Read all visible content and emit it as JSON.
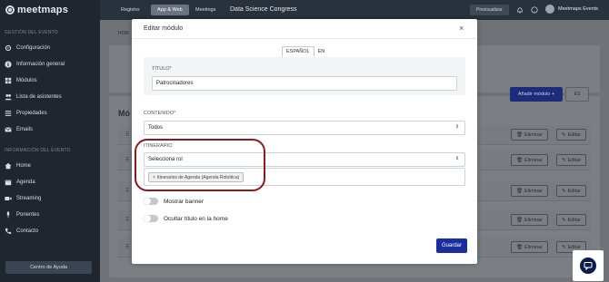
{
  "app": {
    "logo_text": "meetmaps"
  },
  "sidebar": {
    "section_event": "GESTIÓN DEL EVENTO",
    "section_info": "INFORMACIÓN DEL EVENTO",
    "items_event": [
      {
        "label": "Configuración",
        "icon": "gear-icon"
      },
      {
        "label": "Información general",
        "icon": "info-icon"
      },
      {
        "label": "Módulos",
        "icon": "modules-icon"
      },
      {
        "label": "Lista de asistentes",
        "icon": "users-icon"
      },
      {
        "label": "Propiedades",
        "icon": "list-icon"
      },
      {
        "label": "Emails",
        "icon": "email-icon"
      }
    ],
    "items_info": [
      {
        "label": "Home",
        "icon": "home-icon"
      },
      {
        "label": "Agenda",
        "icon": "calendar-icon"
      },
      {
        "label": "Streaming",
        "icon": "video-icon"
      },
      {
        "label": "Ponentes",
        "icon": "microphone-icon"
      },
      {
        "label": "Contacto",
        "icon": "phone-icon"
      }
    ],
    "help_label": "Centro de Ayuda"
  },
  "topbar": {
    "tabs": [
      {
        "label": "Registro",
        "active": false
      },
      {
        "label": "App & Web",
        "active": true
      },
      {
        "label": "Meetings",
        "active": false
      }
    ],
    "event_name": "Data Science Congress",
    "preview_label": "Previsualizar",
    "user_name": "Meetmaps Events"
  },
  "background": {
    "breadcrumb": "HOM",
    "title": "Mó",
    "add_module_label": "Añadir módulo +",
    "lang_label": "ES",
    "rows": [
      {
        "delete_label": "Eliminar",
        "edit_label": "Editar"
      },
      {
        "delete_label": "Eliminar",
        "edit_label": "Editar"
      },
      {
        "delete_label": "Eliminar",
        "edit_label": "Editar"
      },
      {
        "delete_label": "Eliminar",
        "edit_label": "Editar"
      },
      {
        "delete_label": "Eliminar",
        "edit_label": "Editar"
      }
    ]
  },
  "modal": {
    "title": "Editar módulo",
    "close": "×",
    "lang_tabs": [
      {
        "label": "ESPAÑOL",
        "active": true
      },
      {
        "label": "EN",
        "active": false
      }
    ],
    "title_label": "TÍTULO*",
    "title_value": "Patrocinadores",
    "content_label": "CONTENIDO*",
    "content_value": "Todos",
    "itinerary_label": "ITINERARIO",
    "itinerary_value": "Selecciona rol",
    "tag_label": "Itinerarios de Agenda (Agenda Robótica)",
    "toggle_banner": "Mostrar banner",
    "toggle_hide_title": "Ocultar título en la home",
    "save_label": "Guardar"
  }
}
